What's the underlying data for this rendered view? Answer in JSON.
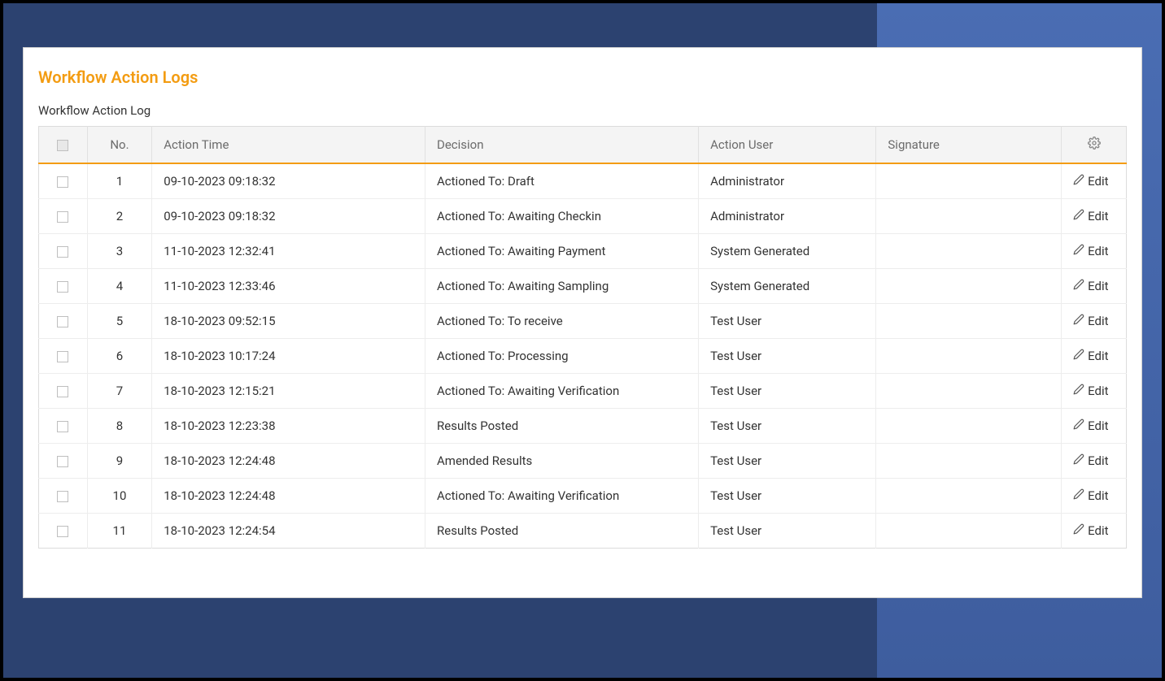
{
  "page": {
    "title": "Workflow Action Logs",
    "subtitle": "Workflow Action Log"
  },
  "table": {
    "headers": {
      "no": "No.",
      "action_time": "Action Time",
      "decision": "Decision",
      "action_user": "Action User",
      "signature": "Signature"
    },
    "edit_label": "Edit",
    "rows": [
      {
        "no": "1",
        "action_time": "09-10-2023 09:18:32",
        "decision": "Actioned To: Draft",
        "action_user": "Administrator",
        "signature": ""
      },
      {
        "no": "2",
        "action_time": "09-10-2023 09:18:32",
        "decision": "Actioned To: Awaiting Checkin",
        "action_user": "Administrator",
        "signature": ""
      },
      {
        "no": "3",
        "action_time": "11-10-2023 12:32:41",
        "decision": "Actioned To: Awaiting Payment",
        "action_user": "System Generated",
        "signature": ""
      },
      {
        "no": "4",
        "action_time": "11-10-2023 12:33:46",
        "decision": "Actioned To: Awaiting Sampling",
        "action_user": "System Generated",
        "signature": ""
      },
      {
        "no": "5",
        "action_time": "18-10-2023 09:52:15",
        "decision": "Actioned To: To receive",
        "action_user": "Test User",
        "signature": ""
      },
      {
        "no": "6",
        "action_time": "18-10-2023 10:17:24",
        "decision": "Actioned To: Processing",
        "action_user": "Test User",
        "signature": ""
      },
      {
        "no": "7",
        "action_time": "18-10-2023 12:15:21",
        "decision": "Actioned To: Awaiting Verification",
        "action_user": "Test User",
        "signature": ""
      },
      {
        "no": "8",
        "action_time": "18-10-2023 12:23:38",
        "decision": "Results Posted",
        "action_user": "Test User",
        "signature": ""
      },
      {
        "no": "9",
        "action_time": "18-10-2023 12:24:48",
        "decision": "Amended Results",
        "action_user": "Test User",
        "signature": ""
      },
      {
        "no": "10",
        "action_time": "18-10-2023 12:24:48",
        "decision": "Actioned To: Awaiting Verification",
        "action_user": "Test User",
        "signature": ""
      },
      {
        "no": "11",
        "action_time": "18-10-2023 12:24:54",
        "decision": "Results Posted",
        "action_user": "Test User",
        "signature": ""
      }
    ]
  }
}
